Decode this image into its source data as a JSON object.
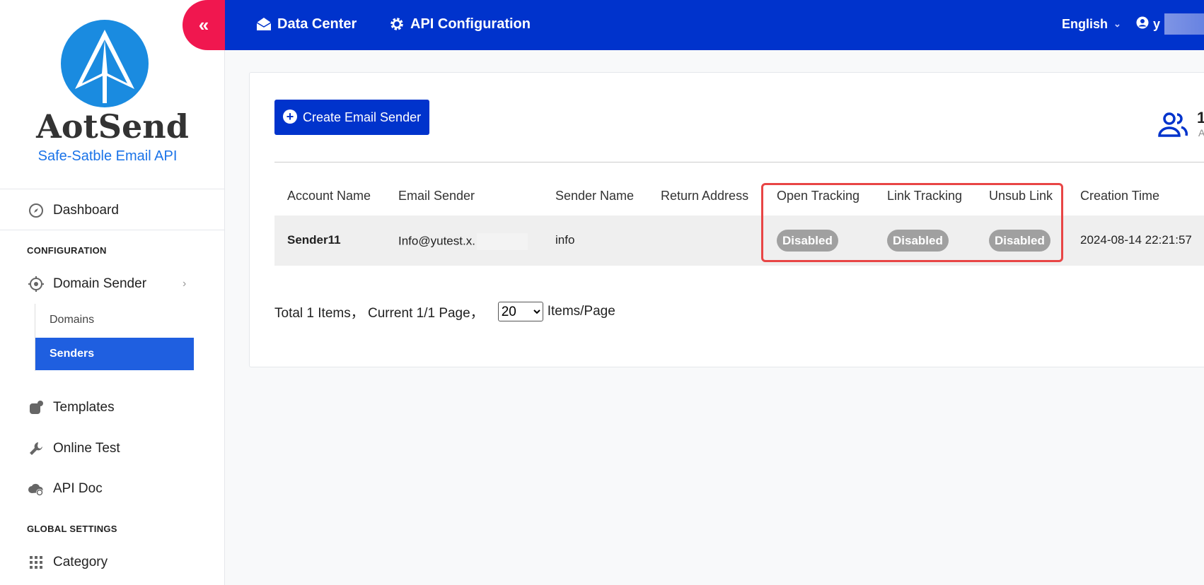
{
  "brand": {
    "name": "AotSend",
    "tagline": "Safe-Satble Email API"
  },
  "sidebar": {
    "dashboard": "Dashboard",
    "section_configuration": "CONFIGURATION",
    "domain_sender": "Domain Sender",
    "sub_items": [
      "Domains",
      "Senders"
    ],
    "templates": "Templates",
    "online_test": "Online Test",
    "api_doc": "API Doc",
    "section_global": "GLOBAL SETTINGS",
    "category": "Category"
  },
  "topbar": {
    "collapse_icon": "«",
    "data_center": "Data Center",
    "api_configuration": "API Configuration",
    "language": "English",
    "user_initial": "y",
    "colors": {
      "bar": "#0033cc",
      "collapse": "#f0174f"
    }
  },
  "toolbar": {
    "create_label": "Create Email Sender",
    "stat_number": "1",
    "stat_sub": "A"
  },
  "table": {
    "headers": [
      "Account Name",
      "Email Sender",
      "Sender Name",
      "Return Address",
      "Open Tracking",
      "Link Tracking",
      "Unsub Link",
      "Creation Time"
    ],
    "rows": [
      {
        "account_name": "Sender11",
        "email_sender": "Info@yutest.x.",
        "sender_name": "info",
        "return_address": "",
        "open_tracking": "Disabled",
        "link_tracking": "Disabled",
        "unsub_link": "Disabled",
        "creation_time": "2024-08-14 22:21:57"
      }
    ]
  },
  "pager": {
    "summary": "Total 1 Items， Current 1/1 Page，",
    "page_size": "20",
    "suffix": "Items/Page"
  }
}
